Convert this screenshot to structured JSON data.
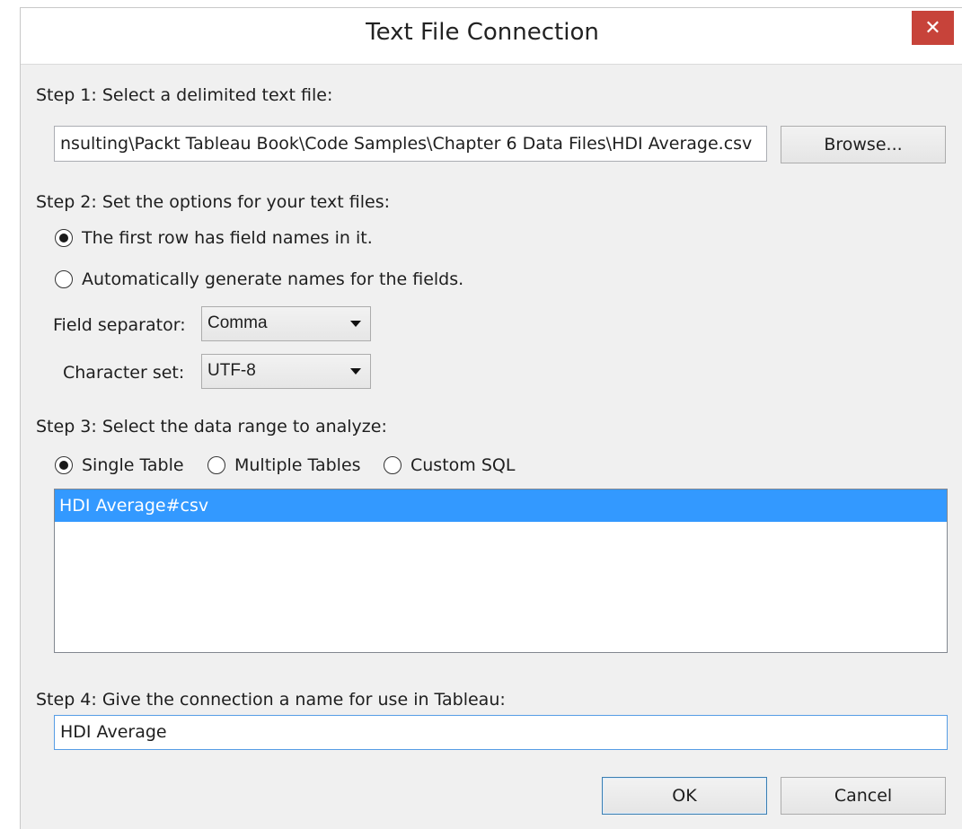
{
  "window": {
    "title": "Text File Connection",
    "close_glyph": "✕"
  },
  "step1": {
    "label": "Step 1: Select a delimited text file:",
    "file_path": "nsulting\\Packt Tableau Book\\Code Samples\\Chapter 6 Data Files\\HDI Average.csv",
    "browse_label": "Browse..."
  },
  "step2": {
    "label": "Step 2: Set the options for your text files:",
    "radio_first_row": "The first row has field names in it.",
    "radio_auto_names": "Automatically generate names for the fields.",
    "field_separator_label": "Field separator:",
    "field_separator_value": "Comma",
    "character_set_label": "Character set:",
    "character_set_value": "UTF-8"
  },
  "step3": {
    "label": "Step 3: Select the data range to analyze:",
    "radio_single": "Single Table",
    "radio_multiple": "Multiple Tables",
    "radio_custom": "Custom SQL",
    "tables": [
      "HDI Average#csv"
    ]
  },
  "step4": {
    "label": "Step 4: Give the connection a name for use in Tableau:",
    "connection_name": "HDI Average"
  },
  "buttons": {
    "ok": "OK",
    "cancel": "Cancel"
  }
}
